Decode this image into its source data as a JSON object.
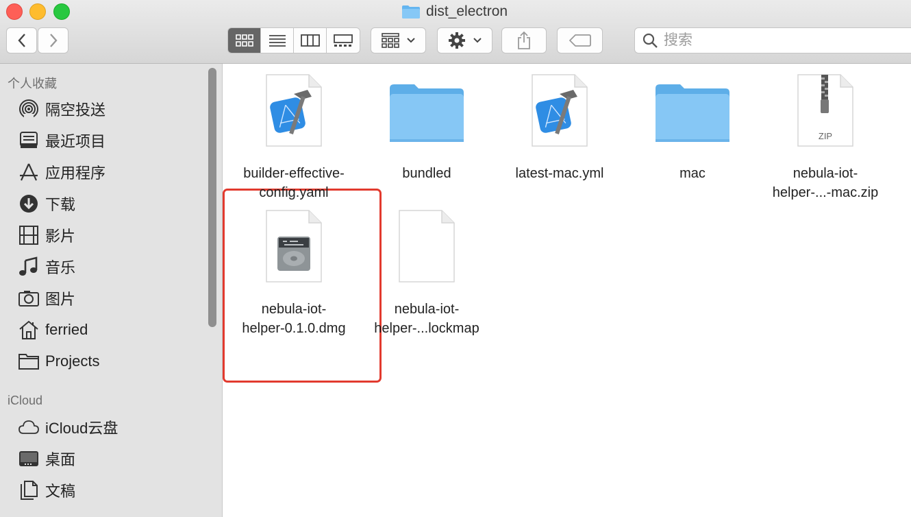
{
  "window": {
    "title": "dist_electron"
  },
  "toolbar": {
    "search_placeholder": "搜索",
    "view_modes": [
      "icon-view",
      "list-view",
      "column-view",
      "gallery-view"
    ],
    "active_view": "icon-view"
  },
  "sidebar": {
    "favorites_title": "个人收藏",
    "favorites": [
      {
        "label": "隔空投送",
        "icon": "airdrop-icon"
      },
      {
        "label": "最近项目",
        "icon": "recents-icon"
      },
      {
        "label": "应用程序",
        "icon": "applications-icon"
      },
      {
        "label": "下载",
        "icon": "downloads-icon"
      },
      {
        "label": "影片",
        "icon": "movies-icon"
      },
      {
        "label": "音乐",
        "icon": "music-icon"
      },
      {
        "label": "图片",
        "icon": "pictures-icon"
      },
      {
        "label": "ferried",
        "icon": "home-icon"
      },
      {
        "label": "Projects",
        "icon": "folder-icon"
      }
    ],
    "icloud_title": "iCloud",
    "icloud": [
      {
        "label": "iCloud云盘",
        "icon": "cloud-icon"
      },
      {
        "label": "桌面",
        "icon": "desktop-icon"
      },
      {
        "label": "文稿",
        "icon": "documents-icon"
      }
    ]
  },
  "files": [
    {
      "line1": "builder-effective-",
      "line2": "config.yaml",
      "icon": "xcode-document-icon"
    },
    {
      "line1": "bundled",
      "line2": "",
      "icon": "folder-icon"
    },
    {
      "line1": "latest-mac.yml",
      "line2": "",
      "icon": "xcode-document-icon"
    },
    {
      "line1": "mac",
      "line2": "",
      "icon": "folder-icon"
    },
    {
      "line1": "nebula-iot-",
      "line2": "helper-...-mac.zip",
      "icon": "zip-archive-icon",
      "badge": "ZIP"
    },
    {
      "line1": "nebula-iot-",
      "line2": "helper-0.1.0.dmg",
      "icon": "disk-image-icon",
      "selected": true
    },
    {
      "line1": "nebula-iot-",
      "line2": "helper-...lockmap",
      "icon": "blank-document-icon"
    }
  ],
  "colors": {
    "highlight": "#e23a2e",
    "folder": "#79bff2",
    "sidebar": "#e3e3e3"
  }
}
